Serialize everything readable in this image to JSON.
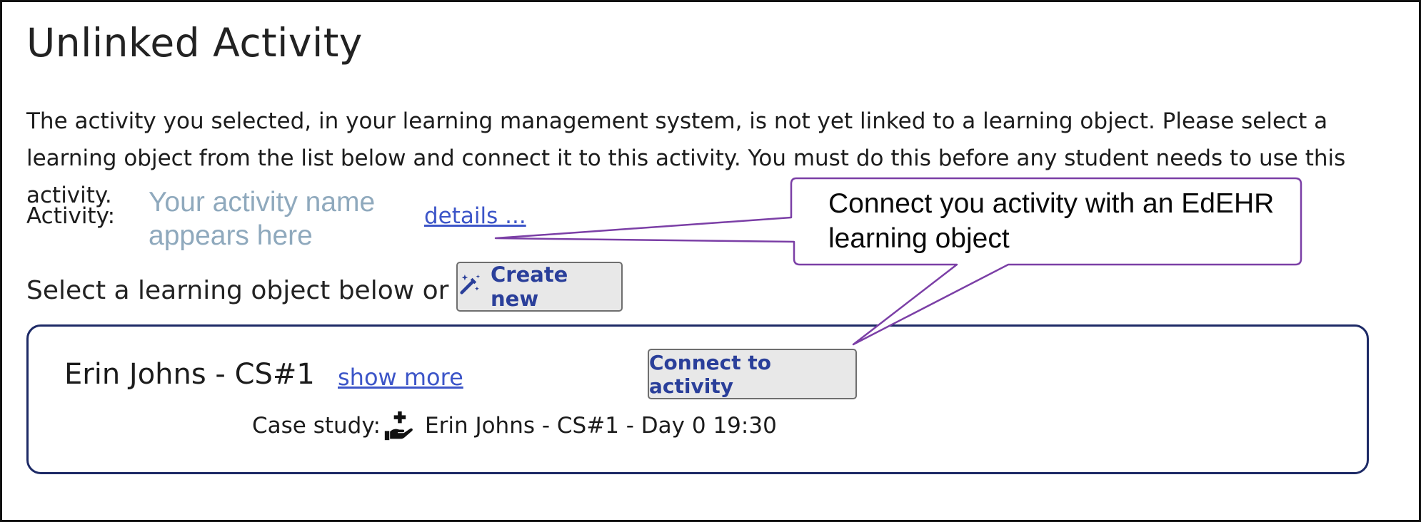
{
  "page": {
    "title": "Unlinked Activity",
    "intro": "The activity you selected, in your learning management system, is not yet linked to a learning object. Please select a learning object from the list below and connect it to this activity. You must do this before any student needs to use this activity."
  },
  "activity": {
    "label": "Activity:",
    "name_placeholder": "Your activity name appears here",
    "details_link": "details ..."
  },
  "select": {
    "prompt": "Select a learning object below or",
    "create_button": "Create new",
    "create_icon": "magic-wand-icon"
  },
  "learning_object": {
    "title": "Erin Johns - CS#1",
    "show_more": "show more",
    "connect_button": "Connect to activity",
    "case_label": "Case study:",
    "case_icon": "hand-holding-medical-icon",
    "case_value": "Erin Johns - CS#1 - Day 0 19:30"
  },
  "callout": {
    "text": "Connect you activity with an EdEHR learning object"
  },
  "colors": {
    "link": "#3c55c8",
    "button_text": "#2a3f9a",
    "placeholder": "#8fa9bd",
    "callout_border": "#7b3fa6",
    "card_border": "#1d2a66"
  }
}
